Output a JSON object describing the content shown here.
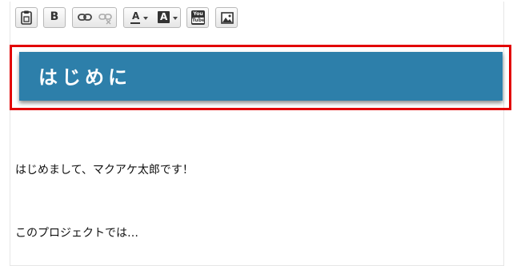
{
  "toolbar": {
    "buttons": [
      {
        "id": "paste",
        "icon": "clipboard-icon"
      },
      {
        "id": "bold",
        "label": "B"
      },
      {
        "id": "link",
        "icon": "link-icon"
      },
      {
        "id": "unlink",
        "icon": "unlink-icon"
      },
      {
        "id": "text-color",
        "label": "A",
        "icon": "chevron-down-icon"
      },
      {
        "id": "bg-color",
        "label": "A",
        "icon": "chevron-down-icon"
      },
      {
        "id": "youtube",
        "label_top": "You",
        "label_bottom": "Tube"
      },
      {
        "id": "image",
        "icon": "image-icon"
      }
    ]
  },
  "content": {
    "heading": "はじめに",
    "heading_bg": "#2d7faa",
    "paragraphs": [
      "はじめまして、マクアケ太郎です！",
      "このプロジェクトでは…"
    ]
  },
  "highlight_color": "#e20000"
}
